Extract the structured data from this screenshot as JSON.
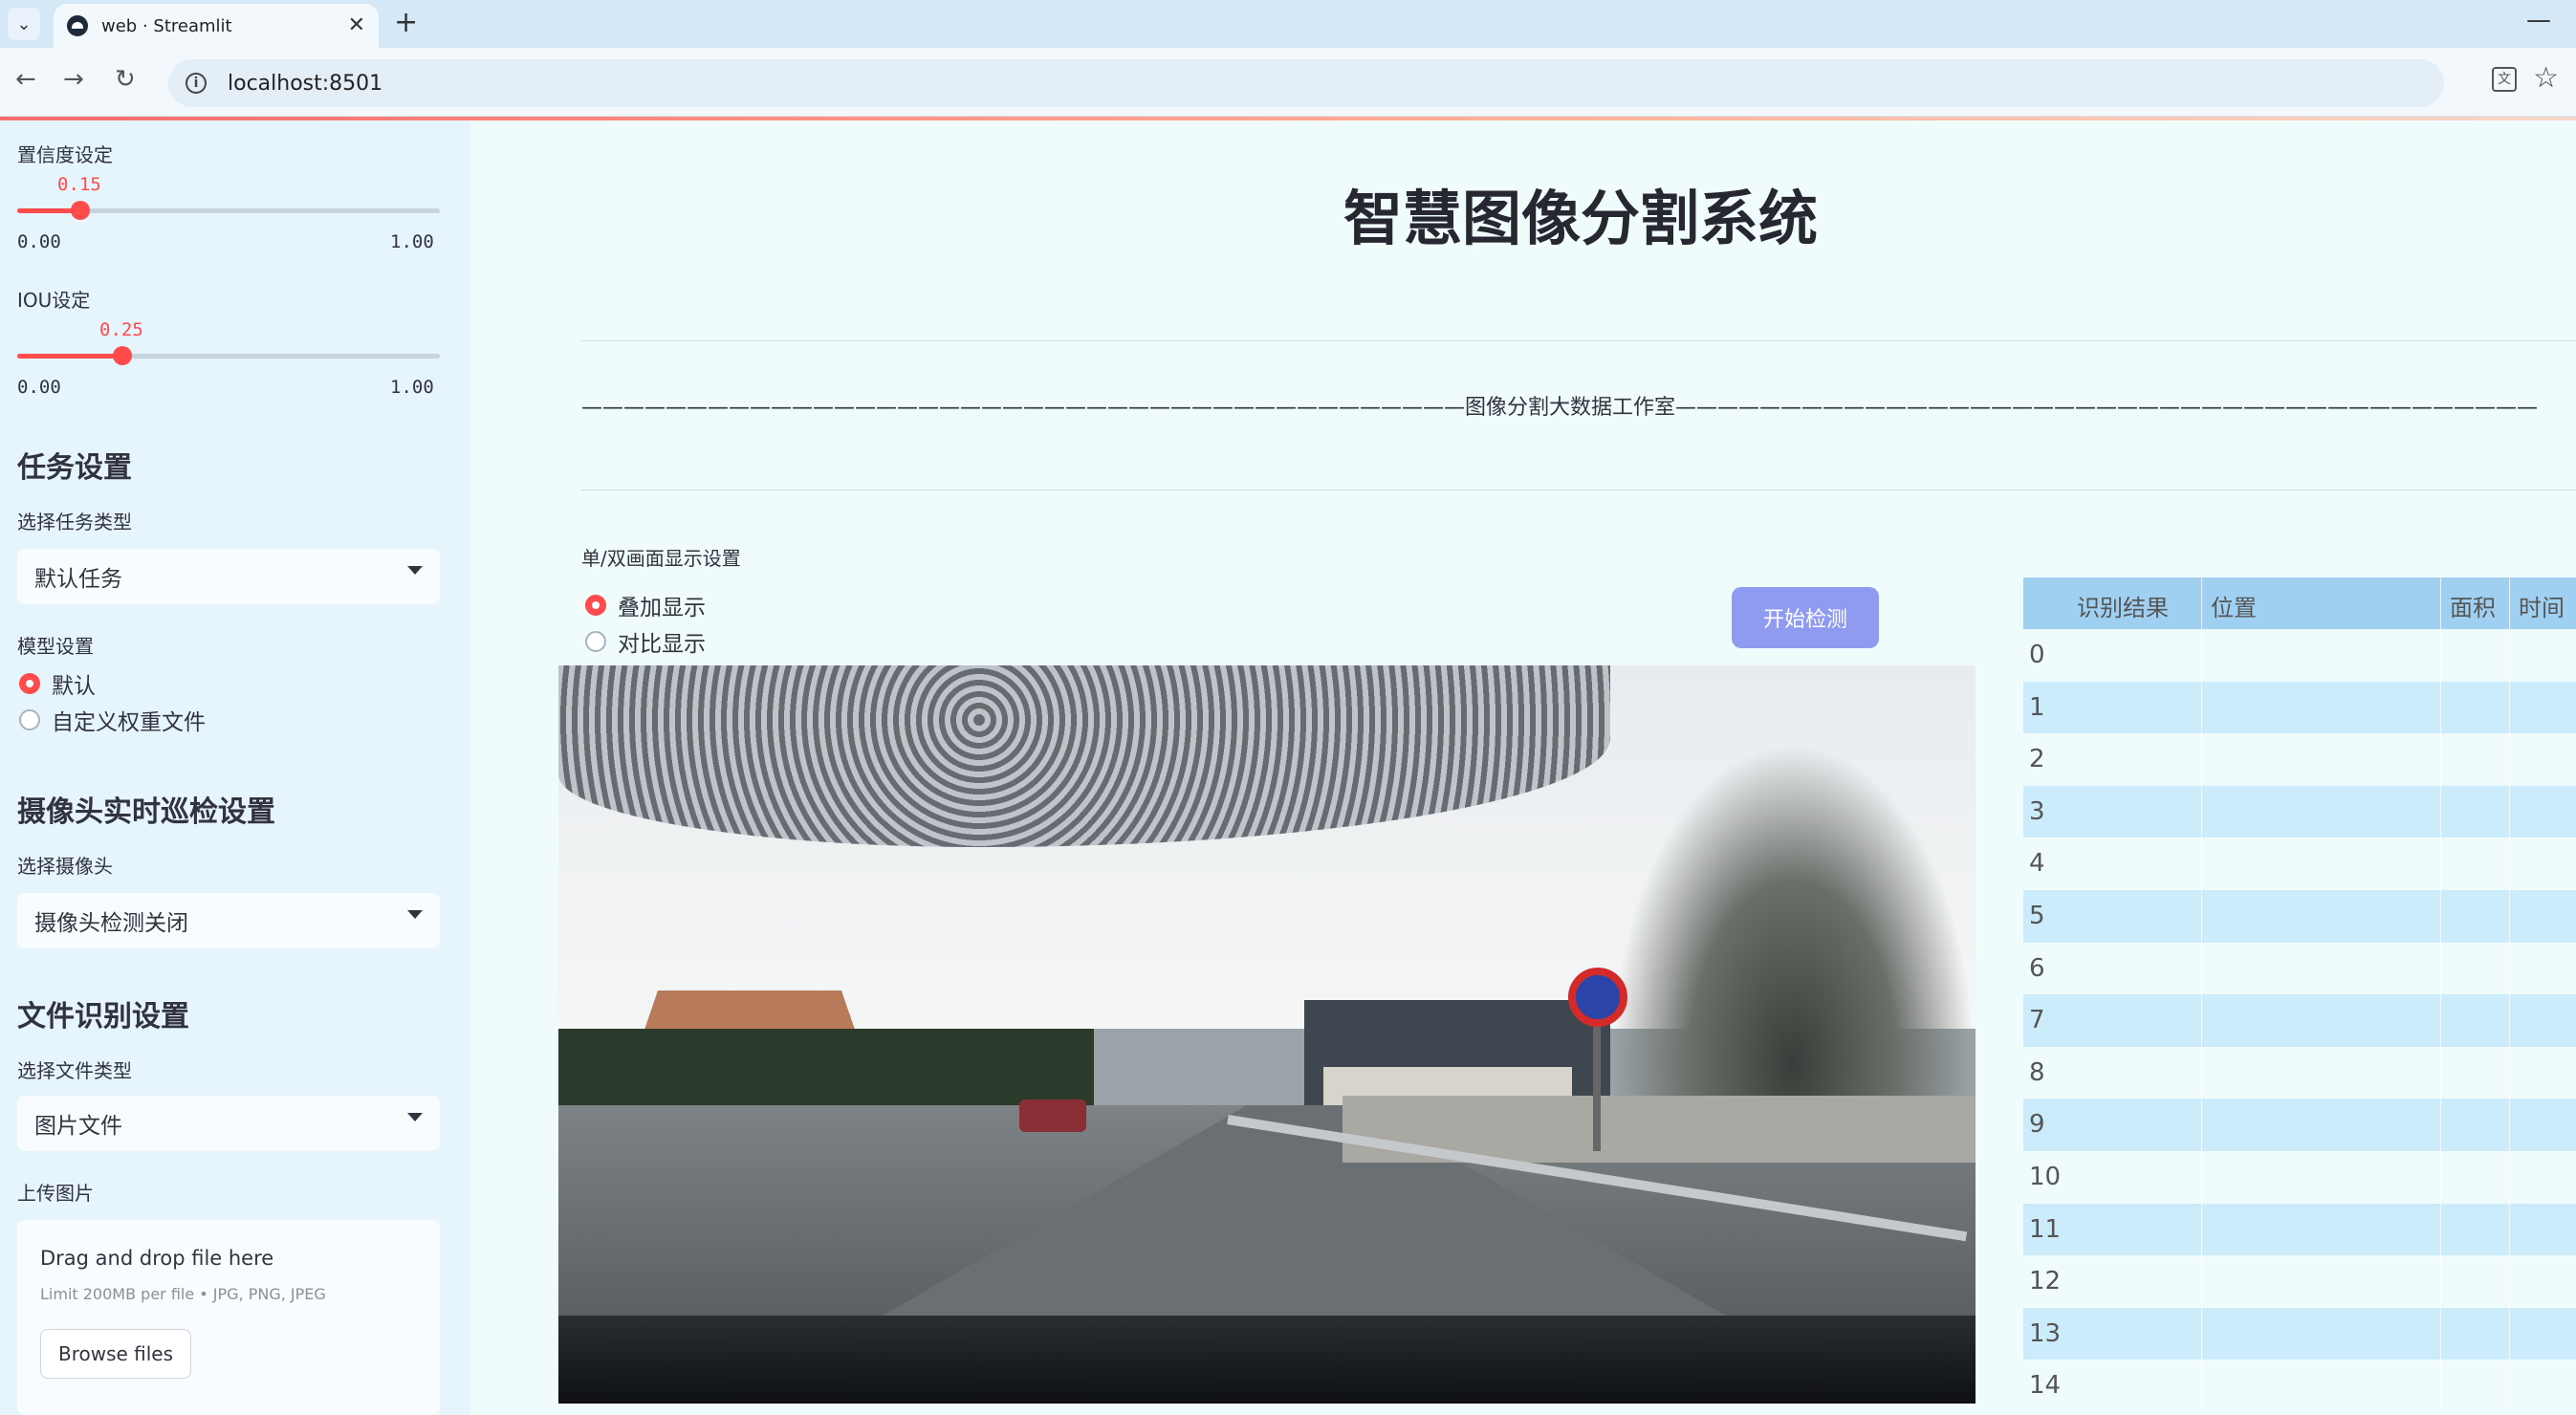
{
  "browser": {
    "tab_title": "web · Streamlit",
    "url": "localhost:8501"
  },
  "sidebar": {
    "confidence": {
      "label": "置信度设定",
      "value": "0.15",
      "value_num": 0.15,
      "min": "0.00",
      "max": "1.00"
    },
    "iou": {
      "label": "IOU设定",
      "value": "0.25",
      "value_num": 0.25,
      "min": "0.00",
      "max": "1.00"
    },
    "task_section": "任务设置",
    "task_type_label": "选择任务类型",
    "task_type_value": "默认任务",
    "model_label": "模型设置",
    "model_options": [
      "默认",
      "自定义权重文件"
    ],
    "camera_section": "摄像头实时巡检设置",
    "camera_label": "选择摄像头",
    "camera_value": "摄像头检测关闭",
    "file_section": "文件识别设置",
    "file_type_label": "选择文件类型",
    "file_type_value": "图片文件",
    "upload_label": "上传图片",
    "uploader": {
      "main": "Drag and drop file here",
      "sub": "Limit 200MB per file • JPG, PNG, JPEG",
      "button": "Browse files"
    }
  },
  "main": {
    "title": "智慧图像分割系统",
    "studio_line": "——————————————————————————————————————————图像分割大数据工作室—————————————————————————————————————————",
    "display_label": "单/双画面显示设置",
    "display_options": [
      "叠加显示",
      "对比显示"
    ],
    "start_button": "开始检测"
  },
  "table": {
    "headers": [
      "识别结果",
      "位置",
      "面积",
      "时间"
    ],
    "rows": [
      "0",
      "1",
      "2",
      "3",
      "4",
      "5",
      "6",
      "7",
      "8",
      "9",
      "10",
      "11",
      "12",
      "13",
      "14"
    ]
  },
  "colors": {
    "accent": "#ff4b4b",
    "button": "#8f9bf0",
    "header": "#9fd0f2",
    "stripe": "#ccebfb"
  }
}
